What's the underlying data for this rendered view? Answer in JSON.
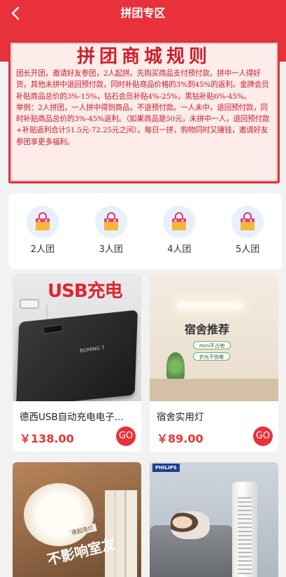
{
  "header": {
    "title": "拼团专区",
    "back_icon": "chevron-left-icon"
  },
  "rules": {
    "title": "拼团商城规则",
    "paragraph_1": "团长开团，邀请好友参团，2人起拼。先购买商品支付预付款，拼中一人得好货，其他未拼中退回预付款，同时补贴商品价格的3%到45%的返利。金牌会员补贴商品总价的3%-15%，钻石会员补贴4%-25%，黑钻补贴6%-45%。",
    "paragraph_2": "举例：2人拼团，一人拼中得到商品，不退预付款。一人未中，退回预付款，同时补贴商品总价的3%-45%返利。（如果商品是50元，未拼中一人，退回预付款+补贴返利合计51.5元-72.25元之间）。每日一拼，购物同时又赚钱，邀请好友参团享更多福利。"
  },
  "teams": [
    {
      "label": "2人团",
      "icon": "shopping-bag-icon"
    },
    {
      "label": "3人团",
      "icon": "shopping-bag-icon"
    },
    {
      "label": "4人团",
      "icon": "shopping-bag-icon"
    },
    {
      "label": "5人团",
      "icon": "shopping-bag-icon"
    }
  ],
  "products": [
    {
      "name": "德西USB自动充电电子...",
      "price": "￥138.00",
      "go": "GO",
      "image_text": "USB充电",
      "image_small_text": "ROMING 7"
    },
    {
      "name": "宿舍实用灯",
      "price": "￥89.00",
      "go": "GO",
      "image_text": "宿舍推荐",
      "image_pill_1": "mini不占地",
      "image_pill_2": "护光不伤眼"
    },
    {
      "name": "",
      "price": "",
      "image_text": "不影响室友",
      "image_tag": "夜起夜灯"
    },
    {
      "name": "",
      "price": "",
      "image_brand": "PHILIPS"
    }
  ],
  "colors": {
    "accent": "#e8313a",
    "price": "#e5353a",
    "rules_text": "#c8202c"
  }
}
